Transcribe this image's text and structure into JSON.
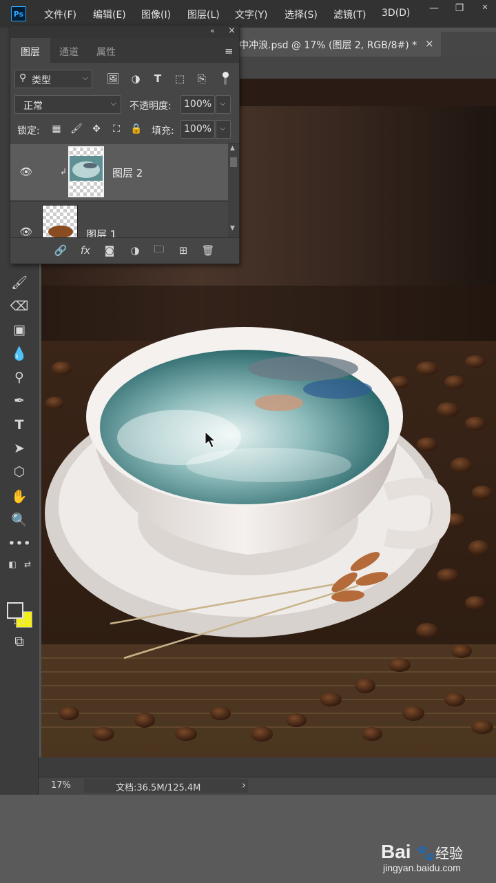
{
  "app": {
    "logo": "Ps",
    "menu": [
      "文件(F)",
      "编辑(E)",
      "图像(I)",
      "图层(L)",
      "文字(Y)",
      "选择(S)",
      "滤镜(T)",
      "3D(D)"
    ],
    "window_controls": {
      "minimize": "—",
      "restore": "❐"
    }
  },
  "document": {
    "tab_title": "中冲浪.psd @ 17% (图层 2, RGB/8#) *",
    "close_glyph": "×"
  },
  "layers_panel": {
    "collapse_glyph": "«",
    "close_glyph": "×",
    "tabs": [
      "图层",
      "通道",
      "属性"
    ],
    "active_tab": "图层",
    "menu_glyph": "≡",
    "filter_kind_label": "类型",
    "blend_mode": "正常",
    "opacity_label": "不透明度:",
    "opacity_value": "100%",
    "lock_label": "锁定:",
    "fill_label": "填充:",
    "fill_value": "100%",
    "layers": [
      {
        "name": "图层 2",
        "visible": true,
        "selected": true,
        "clipped": true
      },
      {
        "name": "图层 1",
        "visible": true,
        "selected": false,
        "clipped": false
      }
    ],
    "footer_icons": [
      "link-icon",
      "fx-icon",
      "mask-icon",
      "adjustment-icon",
      "folder-icon",
      "new-layer-icon",
      "trash-icon"
    ]
  },
  "tools": [
    "brush-icon",
    "eraser-icon",
    "gradient-icon",
    "blur-icon",
    "dodge-icon",
    "pen-icon",
    "type-icon",
    "path-select-icon",
    "shape-icon",
    "hand-icon",
    "zoom-icon",
    "more-icon"
  ],
  "colors": {
    "foreground": "#3a3a3a",
    "background": "#f4ee1c",
    "ps_blue": "#31a8ff"
  },
  "status": {
    "zoom": "17%",
    "doc_info": "文档:36.5M/125.4M",
    "arrow": "›"
  },
  "watermark": {
    "brand": "Bai du经验",
    "url": "jingyan.baidu.com"
  }
}
